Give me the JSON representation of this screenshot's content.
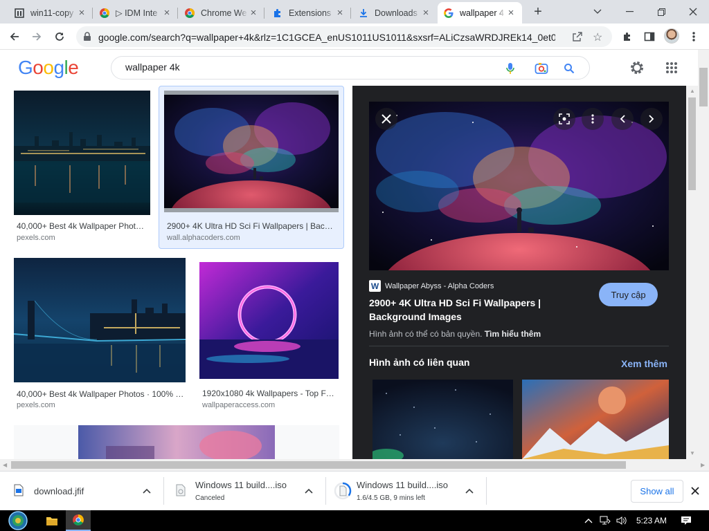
{
  "tabs": [
    {
      "title": "win11-copy",
      "icon": "bookmark-page-icon"
    },
    {
      "title": "▷ IDM Inte",
      "icon": "chrome-icon"
    },
    {
      "title": "Chrome We",
      "icon": "chrome-icon"
    },
    {
      "title": "Extensions",
      "icon": "puzzle-icon"
    },
    {
      "title": "Downloads",
      "icon": "download-icon"
    },
    {
      "title": "wallpaper 4",
      "icon": "google-g-icon"
    }
  ],
  "address": {
    "url": "google.com/search?q=wallpaper+4k&rlz=1C1GCEA_enUS1011US1011&sxsrf=ALiCzsaWRDJREk14_0et0cTt..."
  },
  "google": {
    "logo": {
      "G": "G",
      "o1": "o",
      "o2": "o",
      "g": "g",
      "l": "l",
      "e": "e"
    },
    "query": "wallpaper 4k"
  },
  "results": [
    {
      "caption": "40,000+ Best 4k Wallpaper Phot…",
      "source": "pexels.com"
    },
    {
      "caption": "2900+ 4K Ultra HD Sci Fi Wallpapers | Bac…",
      "source": "wall.alphacoders.com"
    },
    {
      "caption": "40,000+ Best 4k Wallpaper Photos · 100% …",
      "source": "pexels.com"
    },
    {
      "caption": "1920x1080 4k Wallpapers - Top F…",
      "source": "wallpaperaccess.com"
    }
  ],
  "panel": {
    "site": "Wallpaper Abyss - Alpha Coders",
    "site_favicon": "W",
    "title": "2900+ 4K Ultra HD Sci Fi Wallpapers | Background Images",
    "visit": "Truy cập",
    "copyright": "Hình ảnh có thể có bản quyền.",
    "learn_more": "Tìm hiểu thêm",
    "related": "Hình ảnh có liên quan",
    "see_more": "Xem thêm"
  },
  "downloads": [
    {
      "name": "download.jfif",
      "status": ""
    },
    {
      "name": "Windows 11 build....iso",
      "status": "Canceled"
    },
    {
      "name": "Windows 11 build....iso",
      "status": "1.6/4.5 GB, 9 mins left"
    }
  ],
  "download_bar": {
    "show_all": "Show all"
  },
  "taskbar": {
    "time": "5:23 AM"
  },
  "colors": {
    "google_blue": "#4285f4",
    "google_red": "#ea4335",
    "google_yellow": "#fbbc05",
    "google_green": "#34a853",
    "panel_bg": "#202124",
    "accent": "#8ab4f8"
  }
}
